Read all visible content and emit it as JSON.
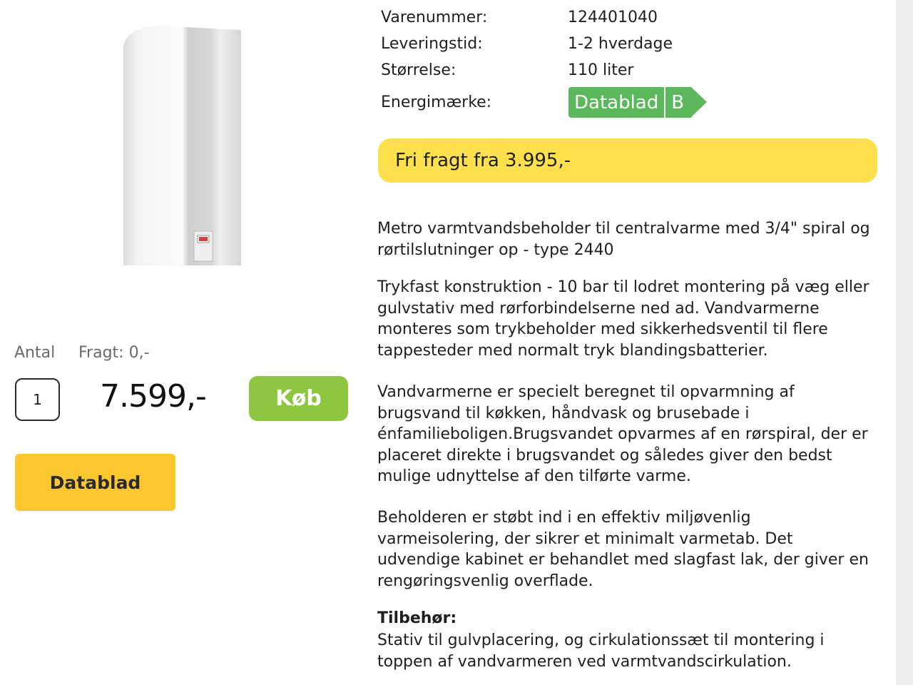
{
  "purchase": {
    "antal_label": "Antal",
    "fragt_label": "Fragt: 0,-",
    "quantity": "1",
    "price": "7.599,-",
    "buy_label": "Køb",
    "datablad_label": "Datablad"
  },
  "specs": [
    {
      "label": "Varenummer:",
      "value": "124401040"
    },
    {
      "label": "Leveringstid:",
      "value": "1-2 hverdage"
    },
    {
      "label": "Størrelse:",
      "value": "110 liter"
    },
    {
      "label": "Energimærke:"
    }
  ],
  "energy": {
    "text": "Datablad",
    "class": "B",
    "color": "#5cb85c"
  },
  "freight_banner": "Fri fragt fra 3.995,-",
  "description": [
    "Metro varmtvandsbeholder til centralvarme med 3/4\" spiral og rørtilslutninger op - type 2440",
    "Trykfast konstruktion - 10 bar til lodret montering på væg eller gulvstativ med rørforbindelserne ned ad. Vandvarmerne monteres som trykbeholder med sikkerhedsventil til flere tappesteder med normalt tryk blandingsbatterier.",
    "Vandvarmerne er specielt beregnet til opvarmning af brugsvand til køkken, håndvask og brusebade i énfamilieboligen.Brugsvandet opvarmes af en rørspiral, der er placeret direkte i brugsvandet og således giver den bedst mulige udnyttelse af den tilførte varme.",
    "Beholderen er støbt ind i en effektiv miljøvenlig varmeisolering, der sikrer et minimalt varmetab. Det udvendige kabinet er behandlet med slagfast lak, der giver en rengøringsvenlig overflade."
  ],
  "accessories": {
    "heading": "Tilbehør:",
    "text": "Stativ til gulvplacering, og cirkulationssæt til montering i toppen af vandvarmeren ved varmtvandscirkulation."
  },
  "colors": {
    "buy": "#8dc63f",
    "datablad": "#fbc62e",
    "freight": "#fde04c"
  }
}
